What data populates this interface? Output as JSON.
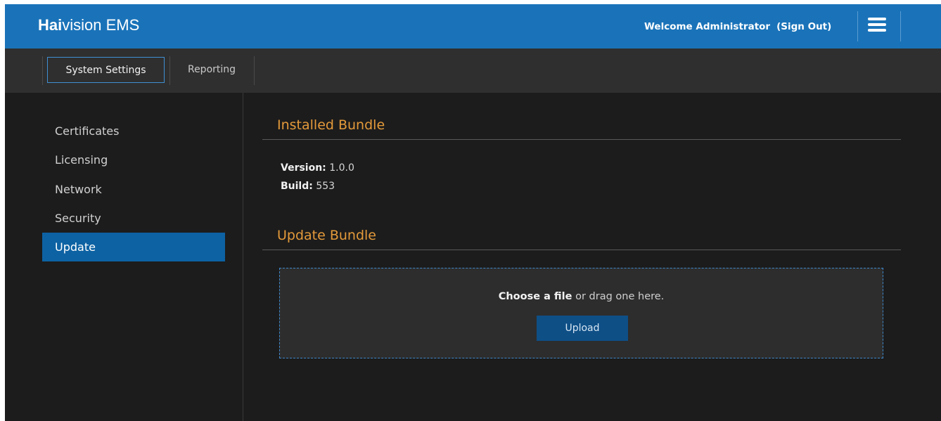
{
  "header": {
    "logo_bold": "Hai",
    "logo_rest": "vision EMS",
    "welcome_text": "Welcome Administrator",
    "sign_out_label": "(Sign Out)",
    "menu_icon": "hamburger-icon"
  },
  "subnav": {
    "tabs": [
      {
        "label": "System Settings",
        "active": true
      },
      {
        "label": "Reporting",
        "active": false
      }
    ]
  },
  "sidebar": {
    "items": [
      {
        "label": "Certificates",
        "active": false
      },
      {
        "label": "Licensing",
        "active": false
      },
      {
        "label": "Network",
        "active": false
      },
      {
        "label": "Security",
        "active": false
      },
      {
        "label": "Update",
        "active": true
      }
    ]
  },
  "installed": {
    "title": "Installed Bundle",
    "version_label": "Version:",
    "version_value": "1.0.0",
    "build_label": "Build:",
    "build_value": "553"
  },
  "update": {
    "title": "Update Bundle",
    "choose_label": "Choose a file",
    "drag_text": " or drag one here.",
    "upload_label": "Upload"
  },
  "colors": {
    "header_bg": "#1a73b9",
    "accent_title": "#e49a3a",
    "active_item": "#0d62a3",
    "upload_button": "#0e4f86"
  }
}
